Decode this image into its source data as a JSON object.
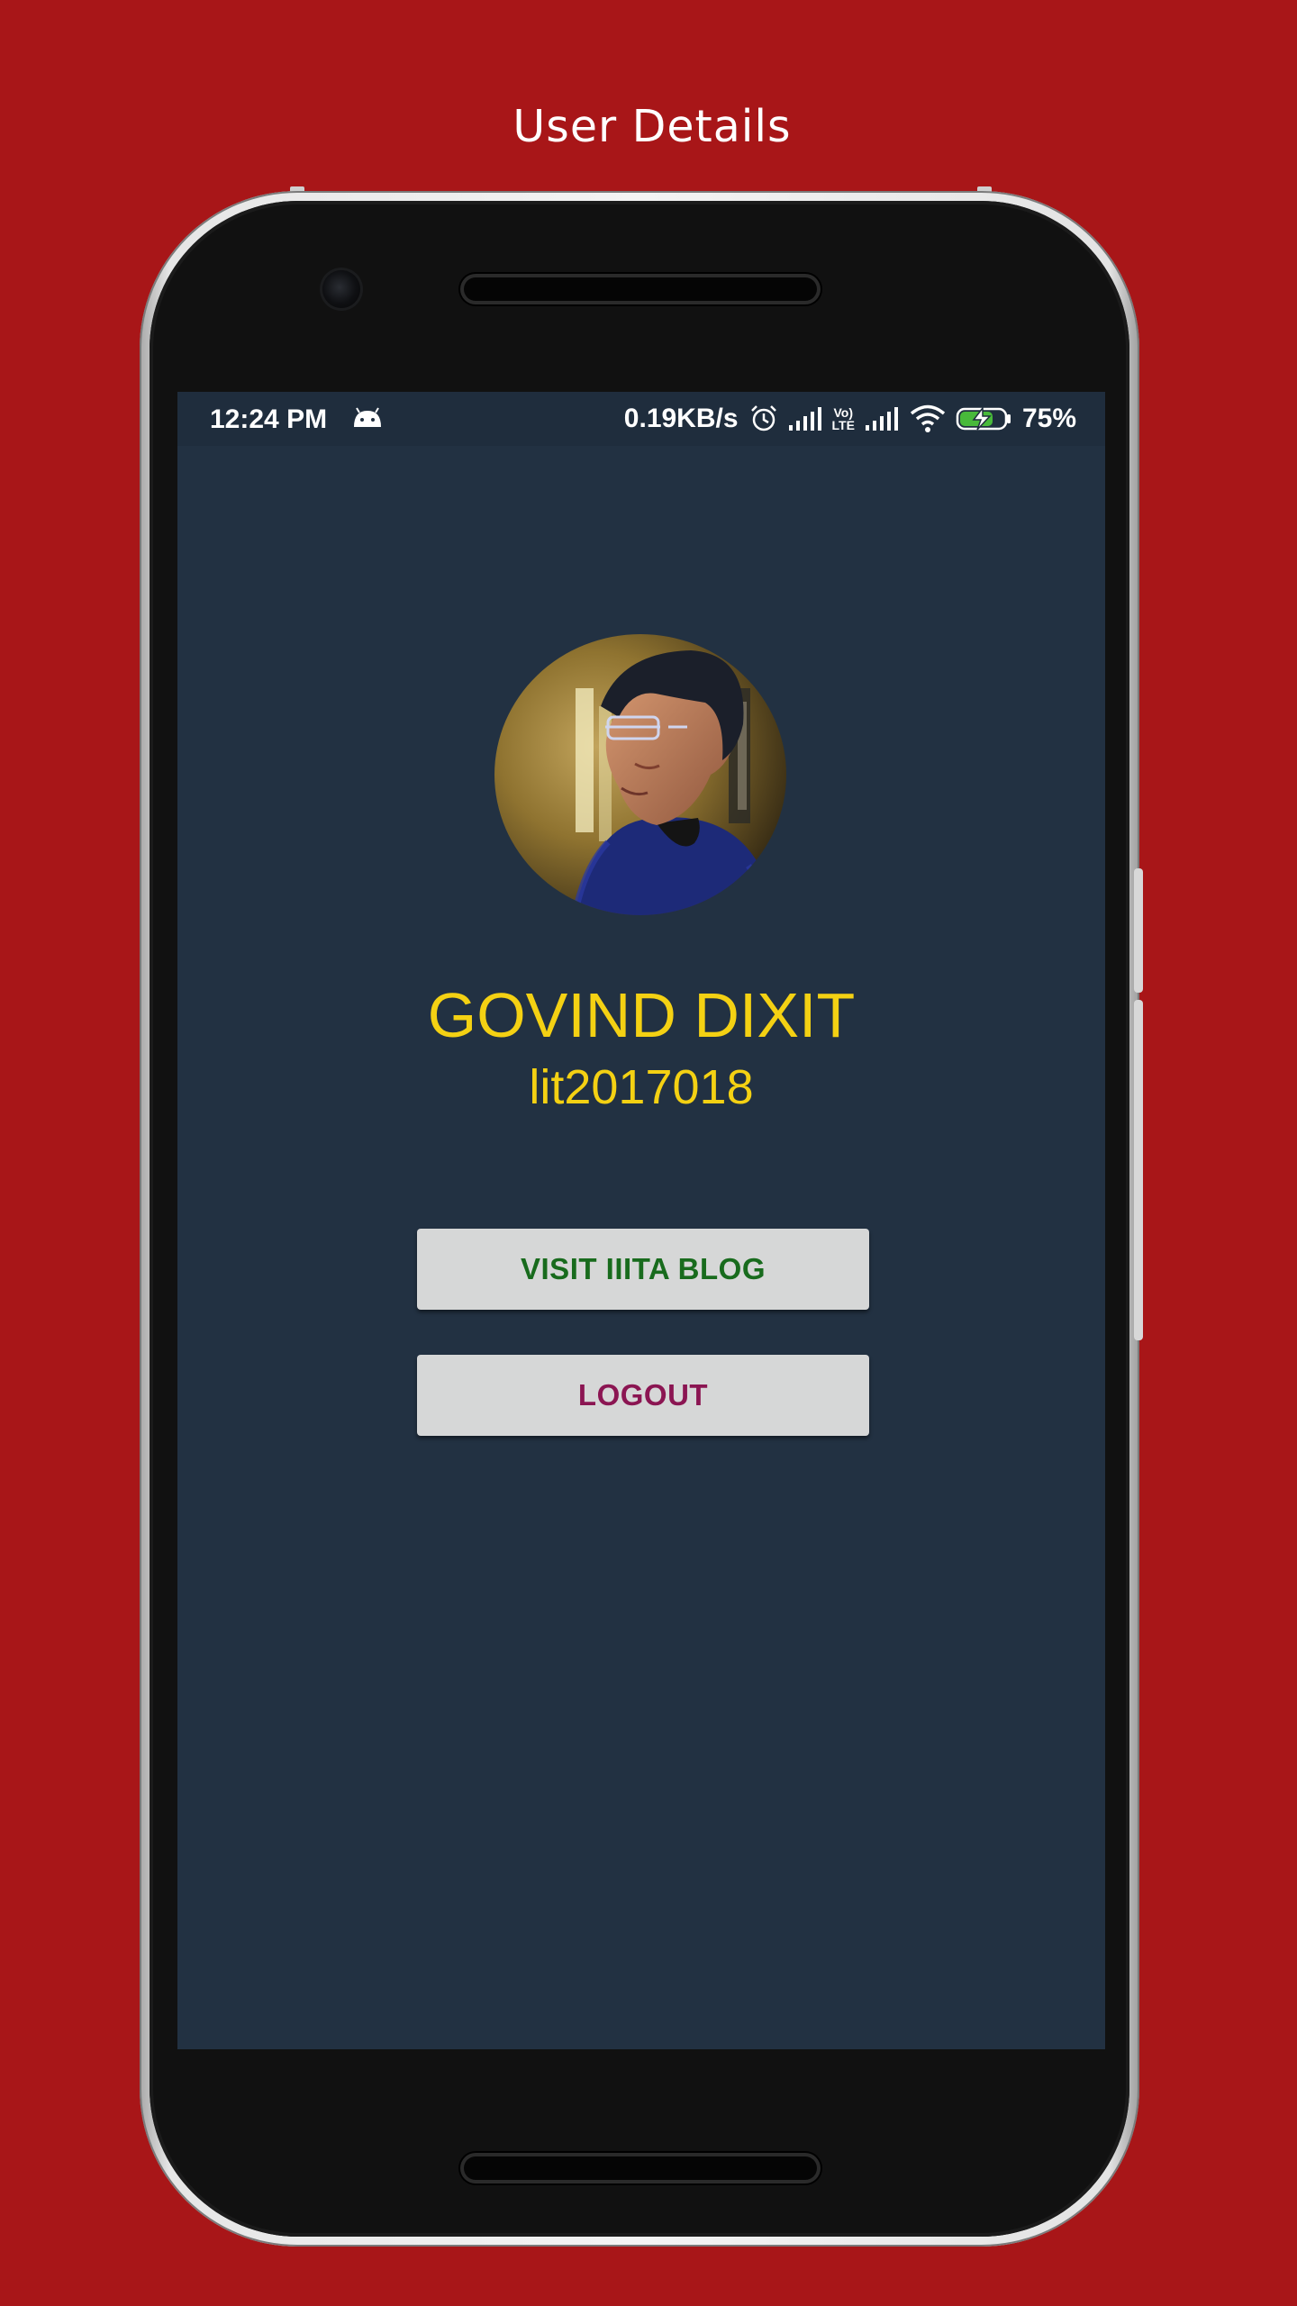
{
  "page_title": "User Details",
  "status_bar": {
    "time": "12:24 PM",
    "network_speed": "0.19KB/s",
    "volte_top": "Vo)",
    "volte_bottom": "LTE",
    "battery_percent": "75%",
    "battery_level": 0.75,
    "icons": [
      "android-icon",
      "alarm-icon",
      "signal-icon",
      "volte-icon",
      "signal-icon",
      "wifi-icon",
      "battery-charging-icon"
    ]
  },
  "profile": {
    "name": "GOVIND DIXIT",
    "user_id": "lit2017018"
  },
  "buttons": {
    "blog_label": "VISIT IIITA BLOG",
    "logout_label": "LOGOUT"
  },
  "colors": {
    "page_background": "#a81618",
    "screen_background": "#223142",
    "profile_text": "#f4d113",
    "button_background": "#d6d7d7",
    "blog_text": "#186b1d",
    "logout_text": "#8b1552"
  }
}
